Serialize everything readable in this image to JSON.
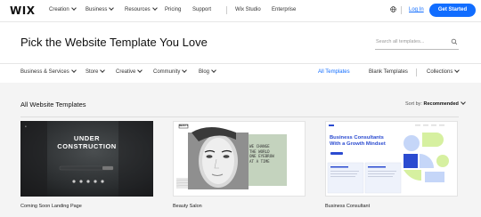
{
  "nav": {
    "logo": "WIX",
    "items": [
      "Creation",
      "Business",
      "Resources",
      "Pricing",
      "Support"
    ],
    "studio": "Wix Studio",
    "enterprise": "Enterprise",
    "login": "Log In",
    "get_started": "Get Started",
    "brand_color": "#116dff"
  },
  "header": {
    "title": "Pick the Website Template You Love",
    "search_placeholder": "Search all templates..."
  },
  "filters": {
    "categories": [
      "Business & Services",
      "Store",
      "Creative",
      "Community",
      "Blog"
    ],
    "all_templates": "All Templates",
    "blank_templates": "Blank Templates",
    "collections": "Collections"
  },
  "section": {
    "title": "All Website Templates",
    "sort_label": "Sort by:",
    "sort_value": "Recommended"
  },
  "cards": [
    {
      "name": "Coming Soon Landing Page",
      "heading_line1": "UNDER",
      "heading_line2": "CONSTRUCTION"
    },
    {
      "name": "Beauty Salon",
      "logo": "BEAUTY",
      "text_lines": [
        "WE CHANGE",
        "THE WORLD",
        "ONE EYEBROW",
        "AT A TIME"
      ]
    },
    {
      "name": "Business Consultant",
      "heading_line1": "Business Consultants",
      "heading_line2": "With a Growth Mindset"
    }
  ]
}
